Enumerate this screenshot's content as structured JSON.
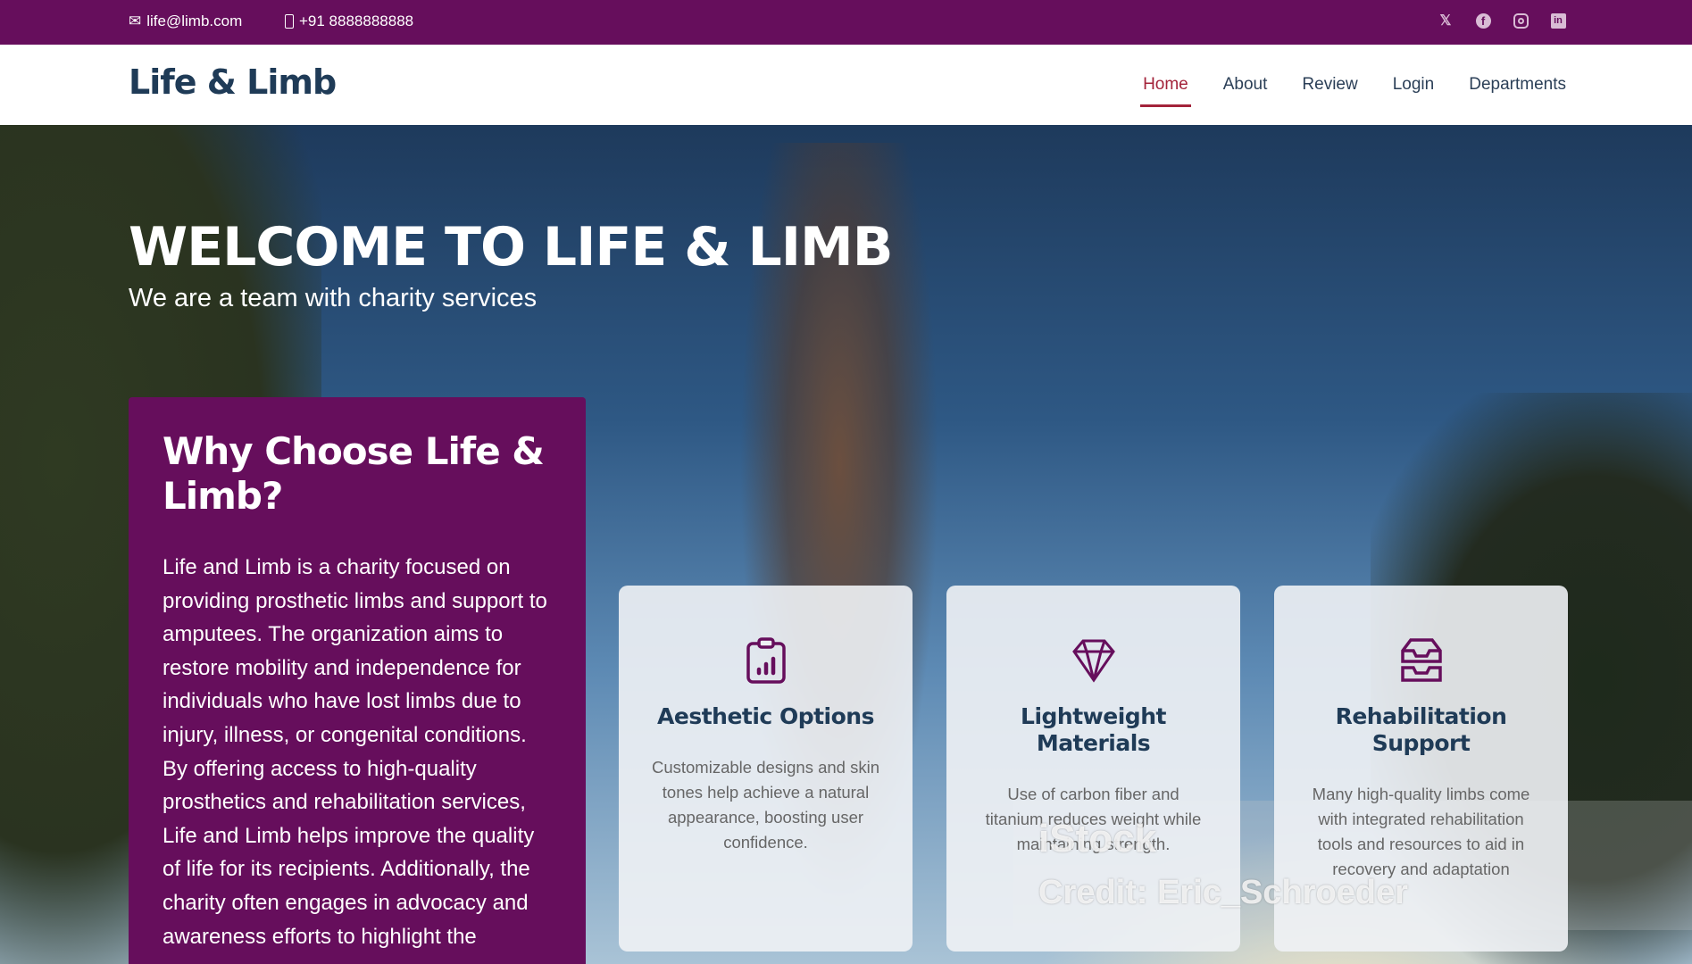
{
  "topbar": {
    "email": "life@limb.com",
    "phone": "+91 8888888888",
    "email_icon": "envelope-icon",
    "phone_icon": "mobile-phone-icon",
    "social": [
      "x-icon",
      "facebook-icon",
      "instagram-icon",
      "linkedin-icon"
    ]
  },
  "header": {
    "logo": "Life & Limb",
    "nav": [
      {
        "label": "Home",
        "active": true
      },
      {
        "label": "About"
      },
      {
        "label": "Review"
      },
      {
        "label": "Login"
      },
      {
        "label": "Departments"
      }
    ]
  },
  "hero": {
    "title": "WELCOME TO LIFE & LIMB",
    "subtitle": "We are a team with charity services"
  },
  "why": {
    "title": "Why Choose Life & Limb?",
    "text": "Life and Limb is a charity focused on providing prosthetic limbs and support to amputees. The organization aims to restore mobility and independence for individuals who have lost limbs due to injury, illness, or congenital conditions. By offering access to high-quality prosthetics and rehabilitation services, Life and Limb helps improve the quality of life for its recipients. Additionally, the charity often engages in advocacy and awareness efforts to highlight the"
  },
  "cards": [
    {
      "icon": "clipboard-chart-icon",
      "title": "Aesthetic Options",
      "text": "Customizable designs and skin tones help achieve a natural appearance, boosting user confidence."
    },
    {
      "icon": "diamond-icon",
      "title": "Lightweight Materials",
      "text": "Use of carbon fiber and titanium reduces weight while maintaining strength."
    },
    {
      "icon": "inbox-tray-icon",
      "title": "Rehabilitation Support",
      "text": "Many high-quality limbs come with integrated rehabilitation tools and resources to aid in recovery and adaptation"
    }
  ],
  "watermark": {
    "brand": "iStock",
    "credit": "Credit: Eric_Schroeder"
  },
  "colors": {
    "brand": "#660e5c",
    "active_nav": "#a3233a",
    "heading": "#1f3b57"
  }
}
